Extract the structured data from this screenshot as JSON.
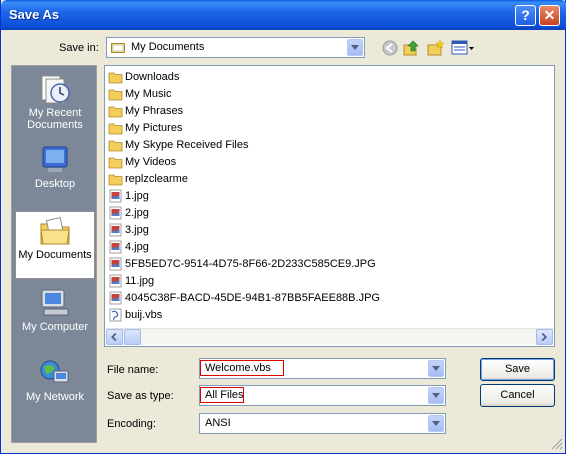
{
  "window": {
    "title": "Save As",
    "help_glyph": "?",
    "close_glyph": "✕"
  },
  "savein": {
    "label": "Save in:",
    "value": "My Documents"
  },
  "places": [
    {
      "label": "My Recent Documents",
      "icon": "recent-documents-icon"
    },
    {
      "label": "Desktop",
      "icon": "desktop-icon"
    },
    {
      "label": "My Documents",
      "icon": "my-documents-icon",
      "selected": true
    },
    {
      "label": "My Computer",
      "icon": "my-computer-icon"
    },
    {
      "label": "My Network",
      "icon": "my-network-icon"
    }
  ],
  "files": [
    {
      "name": "Downloads",
      "type": "folder"
    },
    {
      "name": "My Music",
      "type": "folder"
    },
    {
      "name": "My Phrases",
      "type": "folder"
    },
    {
      "name": "My Pictures",
      "type": "folder"
    },
    {
      "name": "My Skype Received Files",
      "type": "folder"
    },
    {
      "name": "My Videos",
      "type": "folder"
    },
    {
      "name": "replzclearme",
      "type": "folder"
    },
    {
      "name": "1.jpg",
      "type": "image"
    },
    {
      "name": "2.jpg",
      "type": "image"
    },
    {
      "name": "3.jpg",
      "type": "image"
    },
    {
      "name": "4.jpg",
      "type": "image"
    },
    {
      "name": "5FB5ED7C-9514-4D75-8F66-2D233C585CE9.JPG",
      "type": "image"
    },
    {
      "name": "11.jpg",
      "type": "image"
    },
    {
      "name": "4045C38F-BACD-45DE-94B1-87BB5FAEE88B.JPG",
      "type": "image"
    },
    {
      "name": "buij.vbs",
      "type": "script"
    }
  ],
  "form": {
    "filename_label": "File name:",
    "filename_value": "Welcome.vbs",
    "saveastype_label": "Save as type:",
    "saveastype_value": "All Files",
    "encoding_label": "Encoding:",
    "encoding_value": "ANSI"
  },
  "buttons": {
    "save": "Save",
    "cancel": "Cancel"
  },
  "colors": {
    "title_bar": "#0b4fd8",
    "places_bar": "#7c8898",
    "highlight_box": "#e00000"
  }
}
